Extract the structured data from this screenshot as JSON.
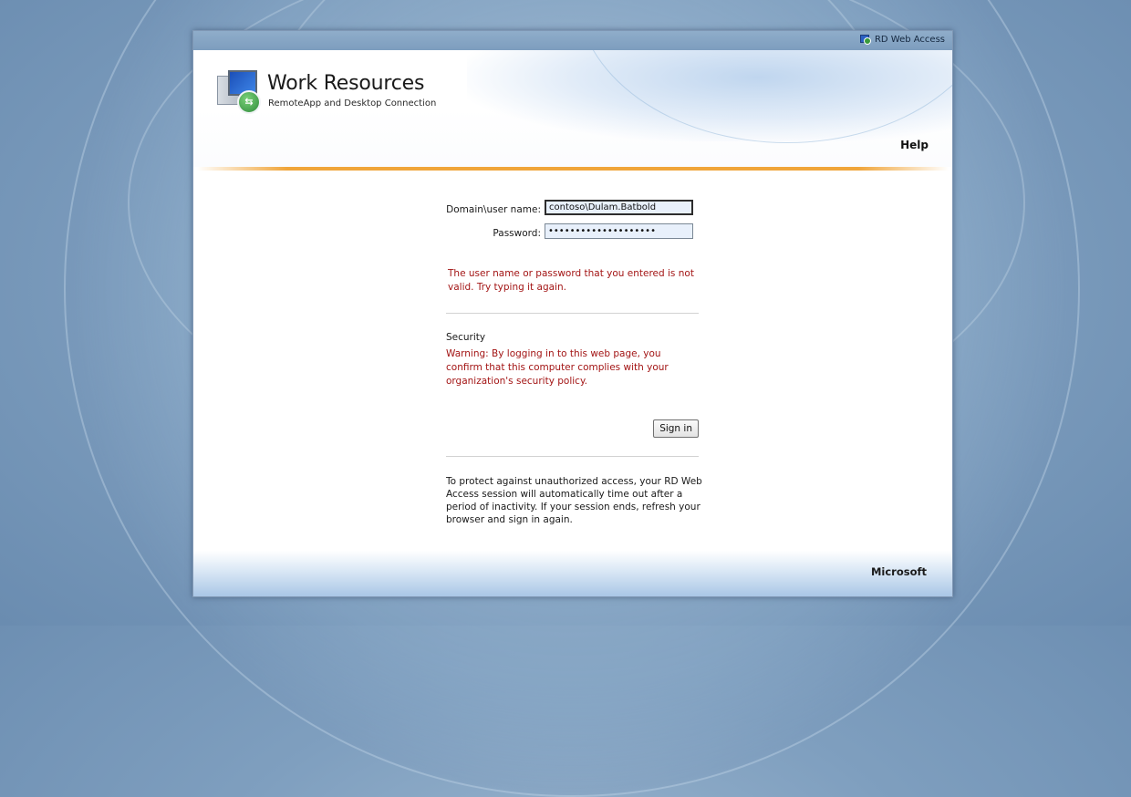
{
  "topbar": {
    "brand_label": "RD Web Access"
  },
  "header": {
    "title": "Work Resources",
    "subtitle": "RemoteApp and Desktop Connection",
    "help_label": "Help"
  },
  "form": {
    "username_label": "Domain\\user name:",
    "username_value": "contoso\\Dulam.Batbold",
    "password_label": "Password:",
    "password_value": "••••••••••••••••••••",
    "error_message": "The user name or password that you entered is not valid. Try typing it again.",
    "security_title": "Security",
    "security_warning": "Warning: By logging in to this web page, you confirm that this computer complies with your organization's security policy.",
    "signin_label": "Sign in",
    "timeout_note": "To protect against unauthorized access, your RD Web Access session will automatically time out after a period of inactivity. If your session ends, refresh your browser and sign in again."
  },
  "footer": {
    "brand": "Microsoft"
  },
  "colors": {
    "accent_rule": "#f0a53a",
    "error_text": "#a31515",
    "topbar": "#8fadca"
  },
  "icons": [
    "rd-web-access-icon",
    "remoteapp-logo-icon"
  ]
}
